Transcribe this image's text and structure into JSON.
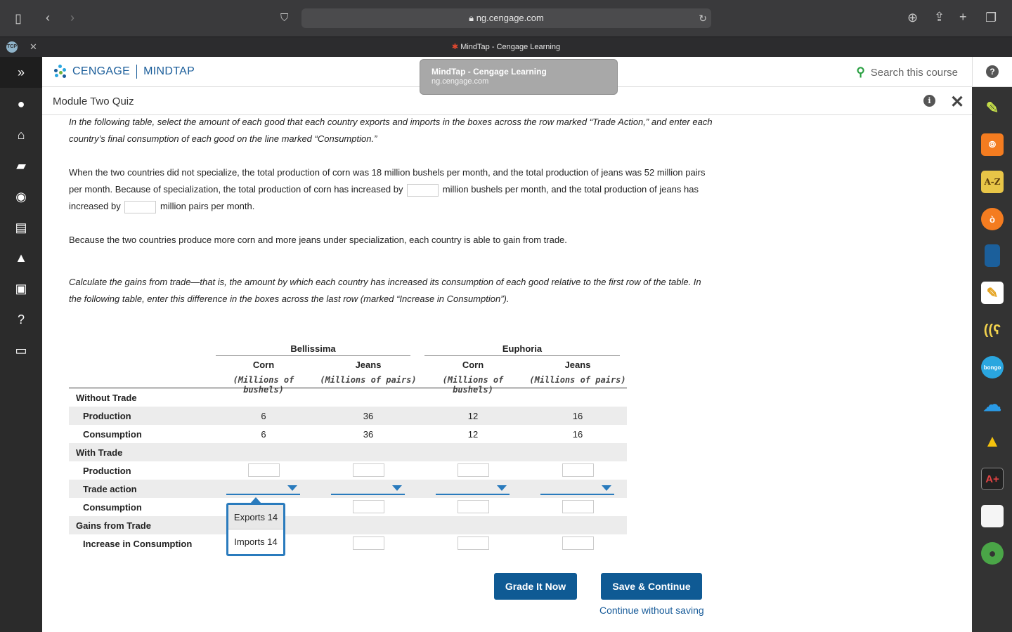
{
  "browser": {
    "url": "ng.cengage.com",
    "tab_title": "MindTap - Cengage Learning",
    "tooltip_title": "MindTap - Cengage Learning",
    "tooltip_url": "ng.cengage.com"
  },
  "header": {
    "brand_left": "CENGAGE",
    "brand_right": "MINDTAP",
    "search_placeholder": "Search this course",
    "module_title": "Module Two Quiz"
  },
  "content": {
    "instruction1": "In the following table, select the amount of each good that each country exports and imports in the boxes across the row marked “Trade Action,” and enter each country’s final consumption of each good on the line marked “Consumption.”",
    "p2_part1": "When the two countries did not specialize, the total production of corn was 18 million bushels per month, and the total production of jeans was 52 million pairs per month. Because of specialization, the total production of corn has increased by",
    "p2_part2": "million bushels per month, and the total production of jeans has increased by",
    "p2_part3": "million pairs per month.",
    "p3": "Because the two countries produce more corn and more jeans under specialization, each country is able to gain from trade.",
    "instruction2": "Calculate the gains from trade—that is, the amount by which each country has increased its consumption of each good relative to the first row of the table. In the following table, enter this difference in the boxes across the last row (marked “Increase in Consumption”)."
  },
  "table": {
    "countries": [
      "Bellissima",
      "Euphoria"
    ],
    "columns": [
      "Corn",
      "Jeans",
      "Corn",
      "Jeans"
    ],
    "units": [
      "(Millions of bushels)",
      "(Millions of pairs)",
      "(Millions of bushels)",
      "(Millions of pairs)"
    ],
    "sections": {
      "without_trade": "Without Trade",
      "with_trade": "With Trade",
      "gains": "Gains from Trade"
    },
    "rows": {
      "production": "Production",
      "consumption": "Consumption",
      "trade_action": "Trade action",
      "increase": "Increase in Consumption"
    },
    "without_production": [
      "6",
      "36",
      "12",
      "16"
    ],
    "without_consumption": [
      "6",
      "36",
      "12",
      "16"
    ]
  },
  "dropdown": {
    "options": [
      "Exports 14",
      "Imports 14"
    ]
  },
  "buttons": {
    "grade": "Grade It Now",
    "save": "Save & Continue",
    "continue_link": "Continue without saving"
  }
}
